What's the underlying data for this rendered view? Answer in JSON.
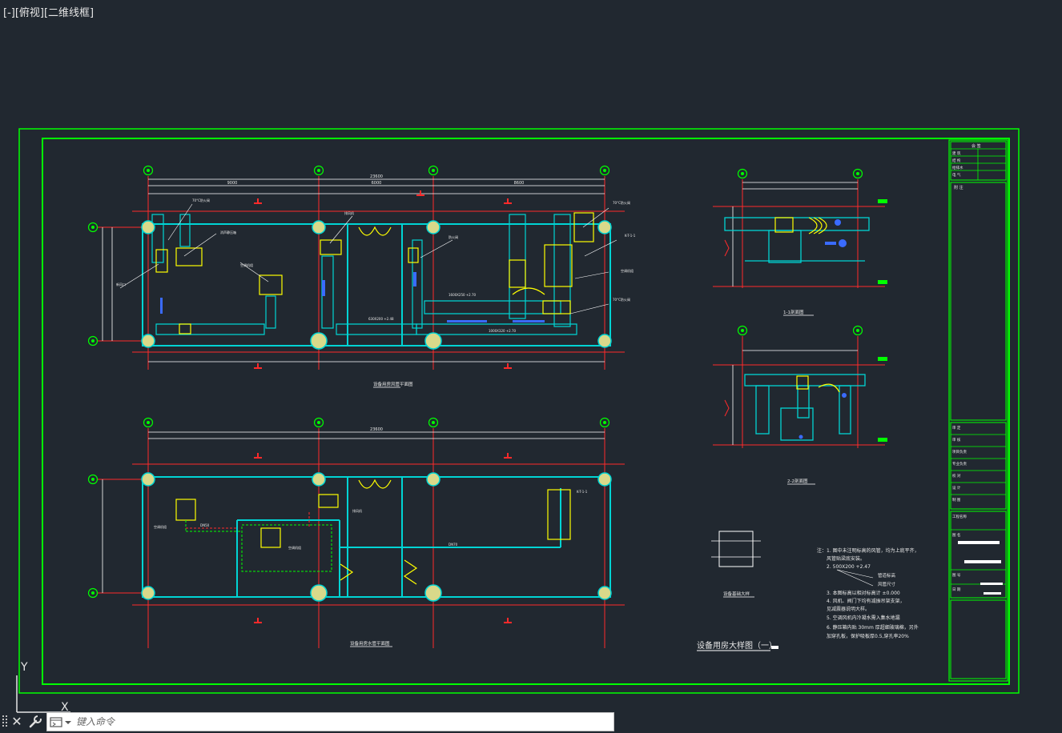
{
  "viewport": {
    "label": "[-][俯视][二维线框]"
  },
  "drawing": {
    "plan_upper_title": "设备用房风管平面图",
    "plan_lower_title": "设备用房水管平面图",
    "section_1_title": "1-1剖面图",
    "section_2_title": "2-2剖面图",
    "detail_title": "设备基础大样",
    "sheet_title": "设备用房大样图（一）",
    "upper_total_dim": "23600",
    "lower_total_dim": "23600",
    "upper_spans": [
      "9000",
      "6000",
      "8600"
    ],
    "axis_bubbles": [
      "1",
      "2",
      "3",
      "4"
    ],
    "notes_lead": "注：",
    "notes": [
      "1. 图中未注明标高的风管，均为上底平齐，",
      "   风管贴梁底安装。",
      "2. 500X200 +2.47",
      "3. 本图标高以相对标高计 ±0.000",
      "4. 风机、阀门下均有减振吊架支架，",
      "   见减震器说明大样。",
      "5. 空调风机内冷凝水需入集水地漏",
      "6. 静压箱内贴 30mm 厚超细玻璃棉，另外",
      "   加穿孔板，保护吸板厚0.5,穿孔率20%"
    ],
    "note_callout_1": "管道标高",
    "note_callout_2": "风管尺寸",
    "colors": {
      "frame": "#00ff00",
      "duct": "#00d4d4",
      "dim": "#ffffff",
      "axis": "#ff2a2a",
      "equip": "#ffff00",
      "fitting": "#3a6bff"
    }
  },
  "title_block": {
    "header": "会 签",
    "rows": [
      "建 筑",
      "结 构",
      "给排水",
      "电 气"
    ],
    "remarks_label": "附 注",
    "labels": [
      "审 定",
      "审 核",
      "项目负责",
      "专业负责",
      "校 对",
      "设 计",
      "制 图"
    ],
    "project_label": "工程名称",
    "drawing_label": "图 名",
    "number_label": "图 号",
    "date_label": "日 期"
  },
  "ucs": {
    "y_label": "Y",
    "x_label": "X"
  },
  "command_line": {
    "close_icon": "close-icon",
    "customize_icon": "wrench-icon",
    "history_icon": "command-history-icon",
    "placeholder": "键入命令"
  }
}
